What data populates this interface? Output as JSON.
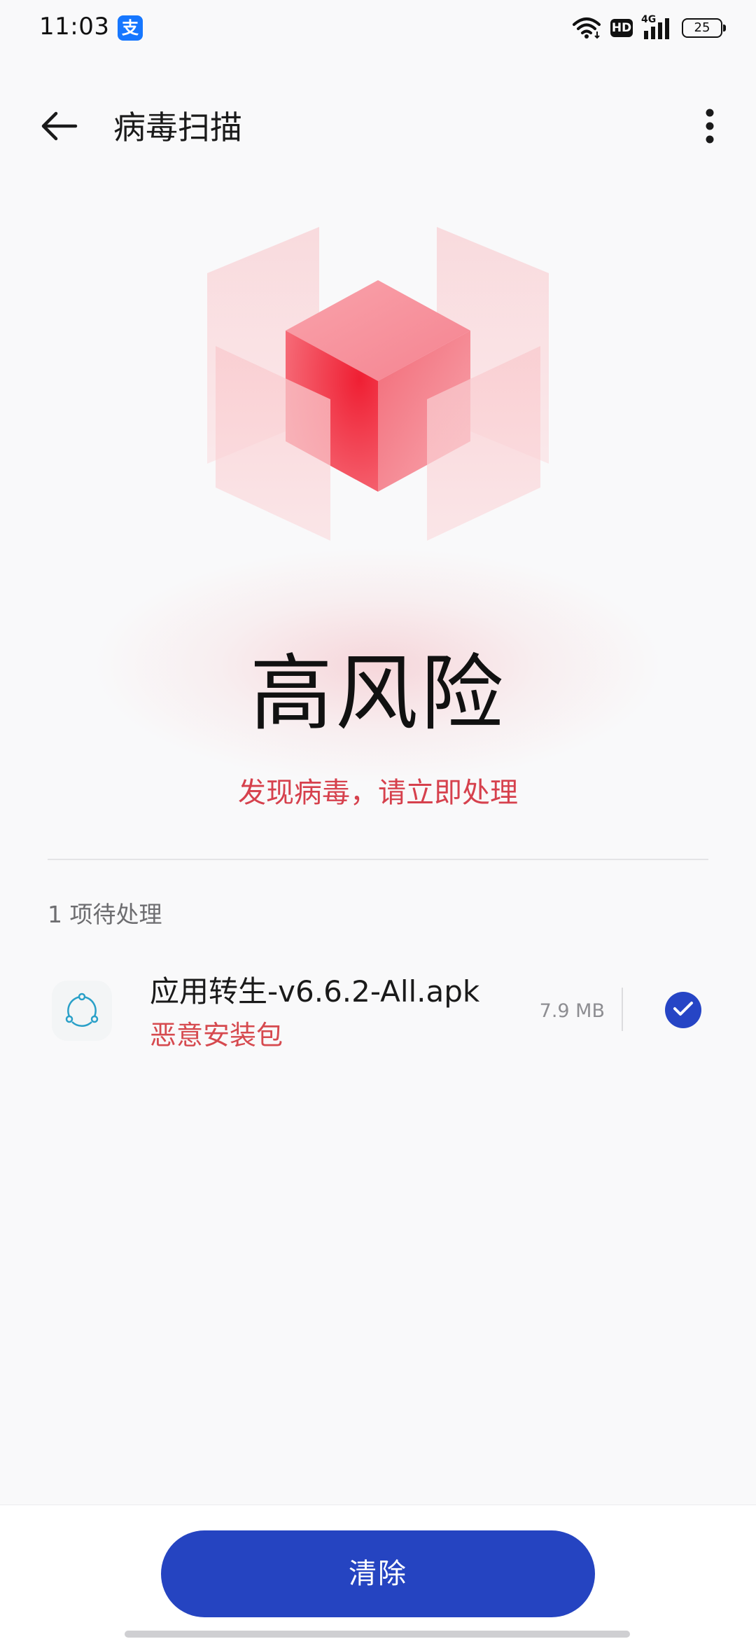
{
  "status_bar": {
    "time": "11:03",
    "alipay_glyph": "支",
    "hd_label": "HD",
    "network_label": "4G",
    "battery_level": "25"
  },
  "header": {
    "title": "病毒扫描",
    "back_icon": "arrow-left-icon",
    "more_icon": "more-vertical-icon"
  },
  "result": {
    "risk_level": "高风险",
    "message": "发现病毒，请立即处理"
  },
  "pending": {
    "section_label": "1 项待处理",
    "items": [
      {
        "name": "应用转生-v6.6.2-All.apk",
        "status": "恶意安装包",
        "size": "7.9 MB",
        "checked": true
      }
    ]
  },
  "actions": {
    "clear_label": "清除"
  },
  "colors": {
    "accent": "#2544c1",
    "danger": "#d64a4f",
    "background": "#f9f9fa"
  }
}
